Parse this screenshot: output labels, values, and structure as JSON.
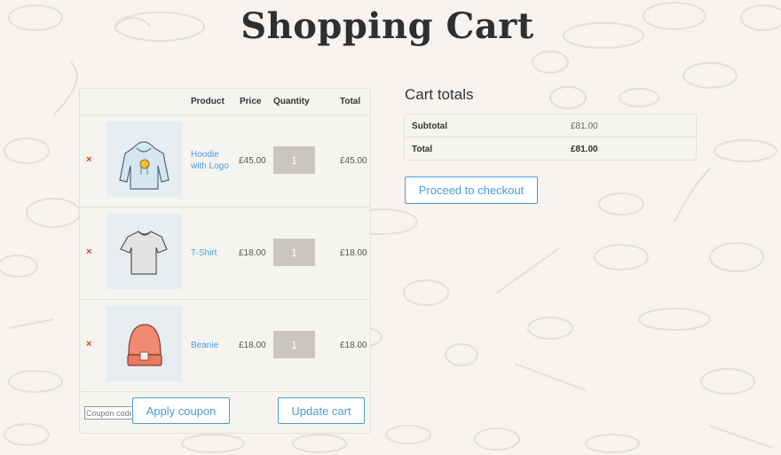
{
  "page": {
    "title": "Shopping Cart"
  },
  "cart": {
    "headers": {
      "product": "Product",
      "price": "Price",
      "quantity": "Quantity",
      "total": "Total"
    },
    "remove_symbol": "×",
    "items": [
      {
        "name": "Hoodie with Logo",
        "price": "£45.00",
        "quantity": "1",
        "total": "£45.00",
        "image_icon": "hoodie-icon"
      },
      {
        "name": "T-Shirt",
        "price": "£18.00",
        "quantity": "1",
        "total": "£18.00",
        "image_icon": "tshirt-icon"
      },
      {
        "name": "Beanie",
        "price": "£18.00",
        "quantity": "1",
        "total": "£18.00",
        "image_icon": "beanie-icon"
      }
    ],
    "coupon_placeholder": "Coupon code",
    "apply_coupon_label": "Apply coupon",
    "update_cart_label": "Update cart"
  },
  "totals": {
    "title": "Cart totals",
    "subtotal_label": "Subtotal",
    "subtotal_value": "£81.00",
    "total_label": "Total",
    "total_value": "£81.00",
    "checkout_label": "Proceed to checkout"
  },
  "colors": {
    "accent": "#4a9bdc",
    "remove": "#e2401c",
    "background": "#f6f3f1"
  }
}
